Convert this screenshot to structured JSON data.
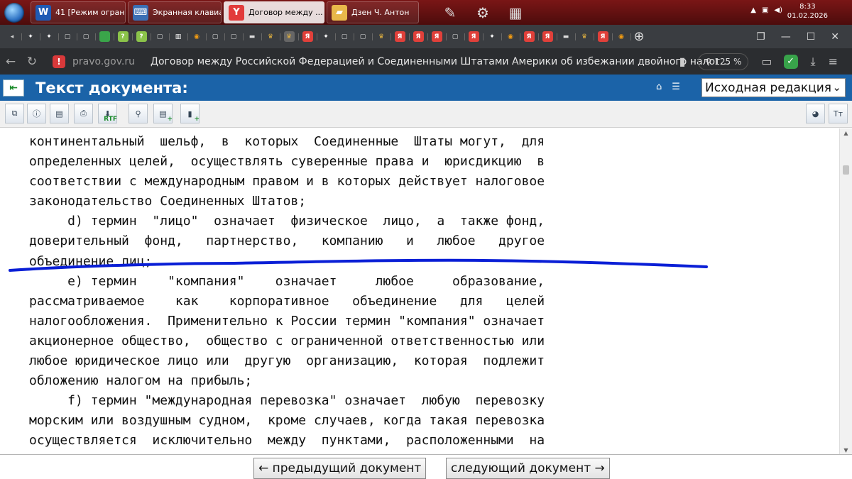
{
  "taskbar": {
    "tasks": [
      {
        "label": "41 [Режим огран...",
        "icon": "word-icon",
        "color": "#1f5bb5",
        "glyph": "W",
        "active": false
      },
      {
        "label": "Экранная клавиа...",
        "icon": "keyboard-icon",
        "color": "#3b6fb4",
        "glyph": "⌨",
        "active": false
      },
      {
        "label": "Договор между ...",
        "icon": "yandex-browser-icon",
        "color": "#e23b3b",
        "glyph": "Y",
        "active": true
      },
      {
        "label": "Дзен Ч. Антон",
        "icon": "folder-icon",
        "color": "#e8b84a",
        "glyph": "▰",
        "active": false
      }
    ],
    "clock_time": "8:33",
    "clock_date": "01.02.2026"
  },
  "browser": {
    "domain": "pravo.gov.ru",
    "page_title": "Договор между Российской Федерацией и Соединенными Штатами Америки об избежании двойного налог...",
    "zoom": "125 %"
  },
  "site": {
    "header_title": "Текст документа:",
    "edition_selected": "Исходная редакция"
  },
  "document": {
    "lines": [
      "континентальный  шельф,  в  которых  Соединенные  Штаты могут,  для",
      "определенных целей,  осуществлять суверенные права и  юрисдикцию  в",
      "соответствии с международным правом и в которых действует налоговое",
      "законодательство Соединенных Штатов;",
      "     d) термин  \"лицо\"  означает  физическое  лицо,  а  также фонд,",
      "доверительный  фонд,   партнерство,   компанию   и   любое   другое",
      "объединение лиц;",
      "     e) термин    \"компания\"    означает     любое     образование,",
      "рассматриваемое    как    корпоративное   объединение   для   целей",
      "налогообложения.  Применительно к России термин \"компания\" означает",
      "акционерное общество,  общество с ограниченной ответственностью или",
      "любое юридическое лицо или  другую  организацию,  которая  подлежит",
      "обложению налогом на прибыль;",
      "     f) термин \"международная перевозка\" означает  любую  перевозку",
      "морским или воздушным судном,  кроме случаев, когда такая перевозка",
      "осуществляется  исключительно  между  пунктами,  расположенными  на"
    ]
  },
  "footer": {
    "prev_label": "← предыдущий документ",
    "next_label": "следующий документ →"
  },
  "colors": {
    "site_header": "#1b63a8",
    "annotation_ink": "#0a1fd6"
  }
}
